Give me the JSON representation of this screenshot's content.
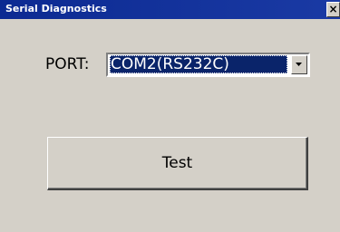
{
  "window": {
    "title": "Serial Diagnostics",
    "close_label": "×"
  },
  "port": {
    "label": "PORT:",
    "selected_value": "COM2(RS232C)"
  },
  "test_button": {
    "label": "Test"
  },
  "colors": {
    "titlebar": "#0c2a92",
    "selection": "#0a246a",
    "face": "#d4d0c8"
  },
  "icons": {
    "close": "close-icon",
    "dropdown": "chevron-down-icon"
  }
}
